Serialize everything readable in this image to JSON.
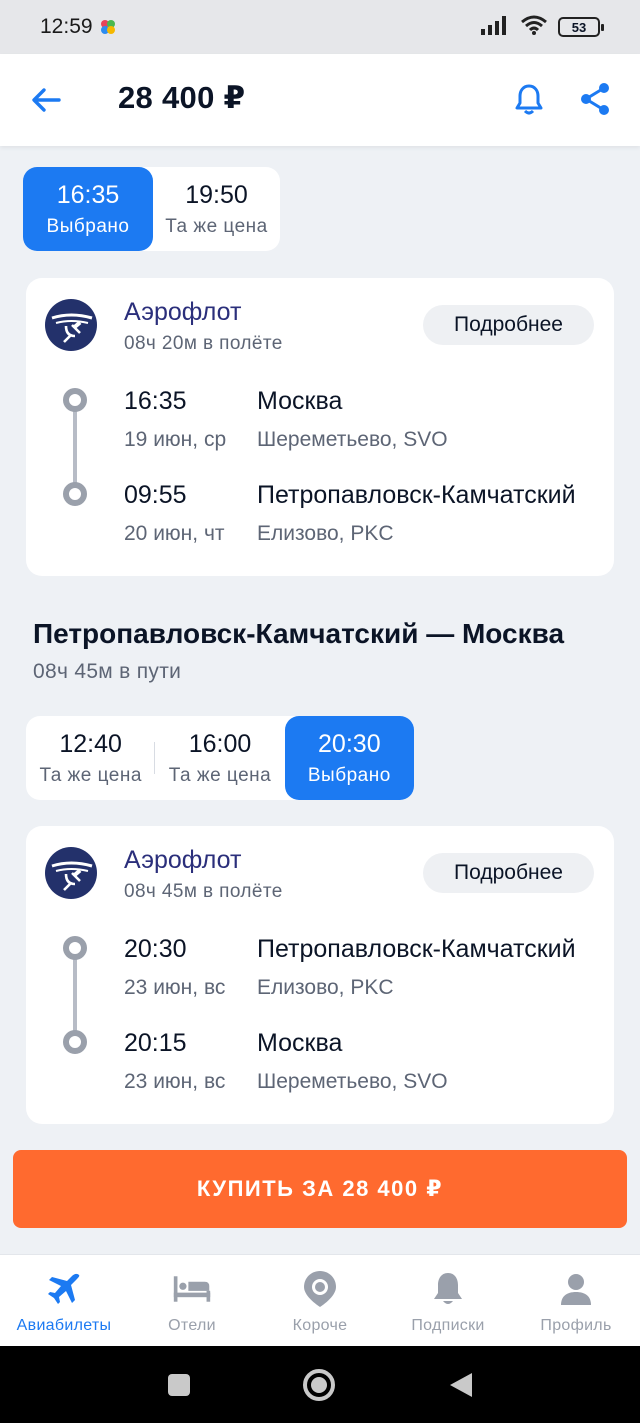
{
  "status": {
    "time": "12:59",
    "battery": "53"
  },
  "header": {
    "title": "28 400 ₽"
  },
  "outbound": {
    "times": [
      {
        "time": "16:35",
        "sub": "Выбрано",
        "selected": true
      },
      {
        "time": "19:50",
        "sub": "Та же цена",
        "selected": false
      }
    ],
    "card": {
      "airline": "Аэрофлот",
      "duration": "08ч 20м в полёте",
      "details": "Подробнее",
      "dep": {
        "time": "16:35",
        "date": "19 июн, ср",
        "city": "Москва",
        "airport": "Шереметьево, SVO"
      },
      "arr": {
        "time": "09:55",
        "date": "20 июн, чт",
        "city": "Петропавловск-Камчатский",
        "airport": "Елизово, PKC"
      }
    }
  },
  "return": {
    "title": "Петропавловск-Камчатский — Москва",
    "travel_time": "08ч 45м в пути",
    "times": [
      {
        "time": "12:40",
        "sub": "Та же цена",
        "selected": false
      },
      {
        "time": "16:00",
        "sub": "Та же цена",
        "selected": false
      },
      {
        "time": "20:30",
        "sub": "Выбрано",
        "selected": true
      }
    ],
    "card": {
      "airline": "Аэрофлот",
      "duration": "08ч 45м в полёте",
      "details": "Подробнее",
      "dep": {
        "time": "20:30",
        "date": "23 июн, вс",
        "city": "Петропавловск-Камчатский",
        "airport": "Елизово, PKC"
      },
      "arr": {
        "time": "20:15",
        "date": "23 июн, вс",
        "city": "Москва",
        "airport": "Шереметьево, SVO"
      }
    }
  },
  "buy_button": "КУПИТЬ ЗА 28 400 ₽",
  "nav": [
    {
      "label": "Авиабилеты",
      "icon": "plane-icon",
      "active": true
    },
    {
      "label": "Отели",
      "icon": "bed-icon",
      "active": false
    },
    {
      "label": "Короче",
      "icon": "camera-pin-icon",
      "active": false
    },
    {
      "label": "Подписки",
      "icon": "bell-icon",
      "active": false
    },
    {
      "label": "Профиль",
      "icon": "person-icon",
      "active": false
    }
  ],
  "colors": {
    "accent": "#1c7af2",
    "buy": "#ff6a2f",
    "airline": "#2b2f7b"
  }
}
